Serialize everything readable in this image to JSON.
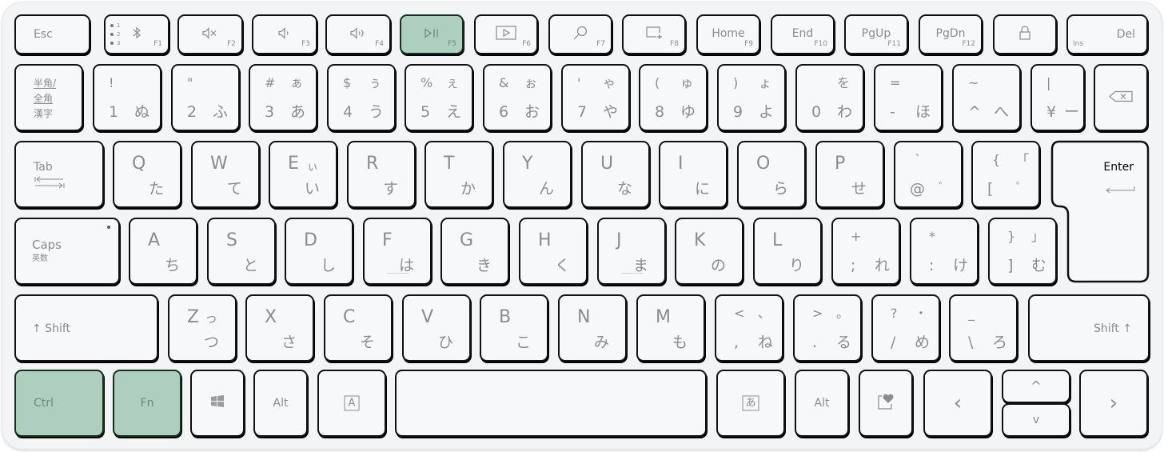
{
  "colors": {
    "board": "#f3f4f6",
    "key": "#f7f8fa",
    "highlight": "#aecfbd",
    "legend": "#8a8c90"
  },
  "row_fn": {
    "esc": "Esc",
    "f1": {
      "icon": "bluetooth-icon",
      "fn": "F1",
      "channels": [
        "1",
        "2",
        "3"
      ]
    },
    "f2": {
      "icon": "mute-icon",
      "fn": "F2"
    },
    "f3": {
      "icon": "volume-down-icon",
      "fn": "F3"
    },
    "f4": {
      "icon": "volume-up-icon",
      "fn": "F4"
    },
    "f5": {
      "icon": "play-pause-icon",
      "glyph": "▷||",
      "fn": "F5",
      "highlighted": true
    },
    "f6": {
      "icon": "slideshow-icon",
      "fn": "F6"
    },
    "f7": {
      "icon": "search-icon",
      "fn": "F7"
    },
    "f8": {
      "icon": "snip-icon",
      "fn": "F8"
    },
    "f9": {
      "label": "Home",
      "fn": "F9"
    },
    "f10": {
      "label": "End",
      "fn": "F10"
    },
    "f11": {
      "label": "PgUp",
      "fn": "F11"
    },
    "f12": {
      "label": "PgDn",
      "fn": "F12"
    },
    "lock": {
      "icon": "lock-icon"
    },
    "del": {
      "label": "Del",
      "sub": "Ins"
    }
  },
  "row_num": {
    "hankaku": [
      "半角/",
      "全角",
      "漢字"
    ],
    "keys": [
      {
        "tl": "!",
        "tr": "",
        "bl": "1",
        "br": "ぬ"
      },
      {
        "tl": "\"",
        "tr": "",
        "bl": "2",
        "br": "ふ"
      },
      {
        "tl": "#",
        "tr": "ぁ",
        "bl": "3",
        "br": "あ"
      },
      {
        "tl": "$",
        "tr": "ぅ",
        "bl": "4",
        "br": "う"
      },
      {
        "tl": "%",
        "tr": "ぇ",
        "bl": "5",
        "br": "え"
      },
      {
        "tl": "&",
        "tr": "ぉ",
        "bl": "6",
        "br": "お"
      },
      {
        "tl": "'",
        "tr": "ゃ",
        "bl": "7",
        "br": "や"
      },
      {
        "tl": "(",
        "tr": "ゅ",
        "bl": "8",
        "br": "ゆ"
      },
      {
        "tl": ")",
        "tr": "ょ",
        "bl": "9",
        "br": "よ"
      },
      {
        "tl": "",
        "tr": "を",
        "bl": "0",
        "br": "わ"
      },
      {
        "tl": "=",
        "tr": "",
        "bl": "-",
        "br": "ほ"
      },
      {
        "tl": "~",
        "tr": "",
        "bl": "^",
        "br": "へ"
      },
      {
        "tl": "|",
        "tr": "",
        "bl": "¥",
        "br": "ー"
      }
    ],
    "backspace": {
      "icon": "backspace-icon"
    }
  },
  "row_q": {
    "tab": "Tab",
    "letters": [
      {
        "l": "Q",
        "k": "た",
        "k2": ""
      },
      {
        "l": "W",
        "k": "て",
        "k2": ""
      },
      {
        "l": "E",
        "k": "い",
        "k2": "ぃ"
      },
      {
        "l": "R",
        "k": "す",
        "k2": ""
      },
      {
        "l": "T",
        "k": "か",
        "k2": ""
      },
      {
        "l": "Y",
        "k": "ん",
        "k2": ""
      },
      {
        "l": "U",
        "k": "な",
        "k2": ""
      },
      {
        "l": "I",
        "k": "に",
        "k2": ""
      },
      {
        "l": "O",
        "k": "ら",
        "k2": ""
      },
      {
        "l": "P",
        "k": "せ",
        "k2": ""
      }
    ],
    "sym": [
      {
        "tl": "`",
        "tr": "",
        "bl": "@",
        "br": "゛"
      },
      {
        "tl": "{",
        "tr": "「",
        "bl": "[",
        "br": "゜"
      }
    ],
    "enter": "Enter"
  },
  "row_a": {
    "caps": "Caps",
    "caps_sub": "英数",
    "letters": [
      {
        "l": "A",
        "k": "ち"
      },
      {
        "l": "S",
        "k": "と"
      },
      {
        "l": "D",
        "k": "し"
      },
      {
        "l": "F",
        "k": "は",
        "bump": true
      },
      {
        "l": "G",
        "k": "き"
      },
      {
        "l": "H",
        "k": "く"
      },
      {
        "l": "J",
        "k": "ま",
        "bump": true
      },
      {
        "l": "K",
        "k": "の"
      },
      {
        "l": "L",
        "k": "り"
      }
    ],
    "sym": [
      {
        "tl": "+",
        "tr": "",
        "bl": ";",
        "br": "れ"
      },
      {
        "tl": "*",
        "tr": "",
        "bl": ":",
        "br": "け"
      },
      {
        "tl": "}",
        "tr": "」",
        "bl": "]",
        "br": "む"
      }
    ]
  },
  "row_z": {
    "lshift": "↑ Shift",
    "letters": [
      {
        "l": "Z",
        "k": "つ",
        "k2": "っ"
      },
      {
        "l": "X",
        "k": "さ",
        "k2": ""
      },
      {
        "l": "C",
        "k": "そ",
        "k2": ""
      },
      {
        "l": "V",
        "k": "ひ",
        "k2": ""
      },
      {
        "l": "B",
        "k": "こ",
        "k2": ""
      },
      {
        "l": "N",
        "k": "み",
        "k2": ""
      },
      {
        "l": "M",
        "k": "も",
        "k2": ""
      }
    ],
    "sym": [
      {
        "tl": "<",
        "tr": "、",
        "bl": ",",
        "br": "ね"
      },
      {
        "tl": ">",
        "tr": "。",
        "bl": ".",
        "br": "る"
      },
      {
        "tl": "?",
        "tr": "・",
        "bl": "/",
        "br": "め"
      },
      {
        "tl": "_",
        "tr": "",
        "bl": "\\",
        "br": "ろ"
      }
    ],
    "rshift": "Shift ↑"
  },
  "row_bottom": {
    "ctrl": "Ctrl",
    "fn": "Fn",
    "win": {
      "icon": "windows-icon"
    },
    "alt_l": "Alt",
    "muhenkan": "A",
    "henkan": "あ",
    "alt_r": "Alt",
    "emoji": {
      "icon": "emoji-heart-icon"
    },
    "left": "‹",
    "up": "^",
    "down": "v",
    "right": "›"
  }
}
